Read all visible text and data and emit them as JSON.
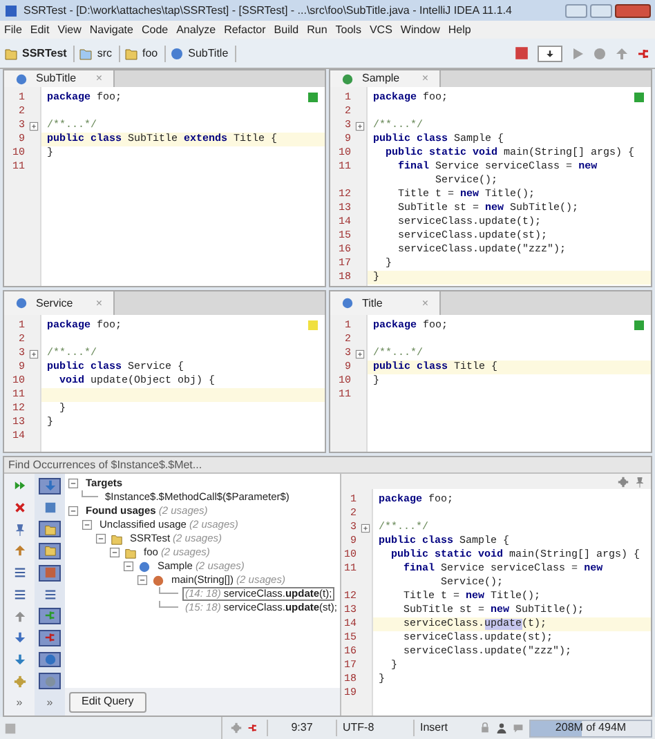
{
  "window": {
    "title": "SSRTest - [D:\\work\\attaches\\tap\\SSRTest] - [SSRTest] - ...\\src\\foo\\SubTitle.java - IntelliJ IDEA 11.1.4"
  },
  "menu": [
    "File",
    "Edit",
    "View",
    "Navigate",
    "Code",
    "Analyze",
    "Refactor",
    "Build",
    "Run",
    "Tools",
    "VCS",
    "Window",
    "Help"
  ],
  "breadcrumbs": [
    {
      "kind": "project",
      "label": "SSRTest"
    },
    {
      "kind": "folder",
      "label": "src"
    },
    {
      "kind": "package",
      "label": "foo"
    },
    {
      "kind": "class",
      "label": "SubTitle"
    }
  ],
  "editors": [
    {
      "tab": {
        "label": "SubTitle",
        "close": "×",
        "kind": "class"
      },
      "color": "#2ea43a",
      "lines": [
        {
          "n": "1",
          "text": "**package** foo;",
          "current": false
        },
        {
          "n": "2",
          "current": false
        },
        {
          "n": "3",
          "text": "/**...*/",
          "kind": "fold",
          "current": false
        },
        {
          "n": "9",
          "text": "**public class** SubTitle **extends** Title {",
          "current": true
        },
        {
          "n": "10",
          "text": "}",
          "current": false
        },
        {
          "n": "11",
          "current": false
        }
      ]
    },
    {
      "tab": {
        "label": "Sample",
        "close": "×",
        "kind": "runnable"
      },
      "color": "#2ea43a",
      "lines": [
        {
          "n": "1",
          "text": "**package** foo;",
          "current": false
        },
        {
          "n": "2",
          "current": false
        },
        {
          "n": "3",
          "text": "/**...*/",
          "kind": "fold",
          "current": false
        },
        {
          "n": "9",
          "text": "**public class** Sample {",
          "current": false
        },
        {
          "n": "10",
          "text": "  **public static void** main(String[] args) {",
          "current": false
        },
        {
          "n": "11",
          "text": "    **final** Service serviceClass = **new**",
          "current": false
        },
        {
          "text": "          Service();",
          "current": false
        },
        {
          "n": "12",
          "text": "    Title t = **new** Title();",
          "current": false
        },
        {
          "n": "13",
          "text": "    SubTitle st = **new** SubTitle();",
          "current": false
        },
        {
          "n": "14",
          "text": "    serviceClass.update(t);",
          "current": false
        },
        {
          "n": "15",
          "text": "    serviceClass.update(st);",
          "current": false
        },
        {
          "n": "16",
          "text": "    serviceClass.update(\"zzz\");",
          "current": false
        },
        {
          "n": "17",
          "text": "  }",
          "current": false
        },
        {
          "n": "18",
          "text": "}",
          "current": true
        }
      ]
    },
    {
      "tab": {
        "label": "Service",
        "close": "×",
        "kind": "class"
      },
      "color": "#f0e040",
      "lines": [
        {
          "n": "1",
          "text": "**package** foo;",
          "current": false
        },
        {
          "n": "2",
          "current": false
        },
        {
          "n": "3",
          "text": "/**...*/",
          "kind": "fold",
          "current": false
        },
        {
          "n": "9",
          "text": "**public class** Service {",
          "current": false
        },
        {
          "n": "10",
          "text": "  **void** update(Object obj) {",
          "current": false
        },
        {
          "n": "11",
          "current": true
        },
        {
          "n": "12",
          "text": "  }",
          "current": false
        },
        {
          "n": "13",
          "text": "}",
          "current": false
        },
        {
          "n": "14",
          "current": false
        }
      ]
    },
    {
      "tab": {
        "label": "Title",
        "close": "×",
        "kind": "class"
      },
      "color": "#2ea43a",
      "lines": [
        {
          "n": "1",
          "text": "**package** foo;",
          "current": false
        },
        {
          "n": "2",
          "current": false
        },
        {
          "n": "3",
          "text": "/**...*/",
          "kind": "fold",
          "current": false
        },
        {
          "n": "9",
          "text": "**public class** Title {",
          "current": true
        },
        {
          "n": "10",
          "text": "}",
          "current": false
        },
        {
          "n": "11",
          "current": false
        }
      ]
    }
  ],
  "find": {
    "title": "Find Occurrences of $Instance$.$Met...",
    "toolbars": [
      {
        "more": "»",
        "buttons": [
          {
            "on": false
          },
          {
            "on": false
          },
          {
            "on": false
          },
          {
            "on": false
          },
          {
            "on": false
          },
          {
            "on": false
          },
          {
            "on": false
          },
          {
            "on": false
          },
          {
            "on": false
          },
          {
            "on": false
          }
        ]
      },
      {
        "more": "»",
        "buttons": [
          {
            "on": true
          },
          {
            "on": false
          },
          {
            "on": true
          },
          {
            "on": true
          },
          {
            "on": true
          },
          {
            "on": false
          },
          {
            "on": true
          },
          {
            "on": true
          },
          {
            "on": true
          },
          {
            "on": true
          }
        ]
      }
    ],
    "tree": [
      {
        "kind": "group",
        "label": "Targets",
        "expanded": true,
        "selected": false,
        "children": [
          {
            "kind": "target",
            "label": "$Instance$.$MethodCall$($Parameter$)",
            "selected": false
          }
        ]
      },
      {
        "kind": "group",
        "label": "Found usages",
        "count": "(2 usages)",
        "expanded": true,
        "selected": false,
        "children": [
          {
            "kind": "plain",
            "label": "Unclassified usage",
            "count": "(2 usages)",
            "expanded": true,
            "selected": false,
            "children": [
              {
                "kind": "project",
                "label": "SSRTest",
                "count": "(2 usages)",
                "expanded": true,
                "selected": false,
                "children": [
                  {
                    "kind": "package",
                    "label": "foo",
                    "count": "(2 usages)",
                    "expanded": true,
                    "selected": false,
                    "children": [
                      {
                        "kind": "class",
                        "label": "Sample",
                        "count": "(2 usages)",
                        "expanded": true,
                        "selected": false,
                        "children": [
                          {
                            "kind": "method",
                            "label": "main(String[])",
                            "count": "(2 usages)",
                            "expanded": true,
                            "selected": false,
                            "children": [
                              {
                                "kind": "usage",
                                "location": "(14: 18)",
                                "label": "serviceClass.**update**(t);",
                                "selected": true
                              },
                              {
                                "kind": "usage",
                                "location": "(15: 18)",
                                "label": "serviceClass.**update**(st);",
                                "selected": false
                              }
                            ]
                          }
                        ]
                      }
                    ]
                  }
                ]
              }
            ]
          }
        ]
      }
    ],
    "edit_button": "Edit Query",
    "preview": {
      "lines": [
        {
          "n": "1",
          "text": "**package** foo;",
          "current": false
        },
        {
          "n": "2",
          "current": false
        },
        {
          "n": "3",
          "text": "/**...*/",
          "kind": "fold",
          "current": false
        },
        {
          "n": "9",
          "text": "**public class** Sample {",
          "current": false
        },
        {
          "n": "10",
          "text": "  **public static void** main(String[] args) {",
          "current": false
        },
        {
          "n": "11",
          "text": "    **final** Service serviceClass = **new**",
          "current": false
        },
        {
          "text": "          Service();",
          "current": false
        },
        {
          "n": "12",
          "text": "    Title t = **new** Title();",
          "current": false
        },
        {
          "n": "13",
          "text": "    SubTitle st = **new** SubTitle();",
          "current": false
        },
        {
          "n": "14",
          "text": "    serviceClass.",
          "match": "update",
          "after": "(t);",
          "current": true
        },
        {
          "n": "15",
          "text": "    serviceClass.update(st);",
          "current": false
        },
        {
          "n": "16",
          "text": "    serviceClass.update(\"zzz\");",
          "current": false
        },
        {
          "n": "17",
          "text": "  }",
          "current": false
        },
        {
          "n": "18",
          "text": "}",
          "current": false
        },
        {
          "n": "19",
          "current": false
        }
      ]
    }
  },
  "status_bar": {
    "position": "9:37",
    "encoding": "UTF-8",
    "mode": "Insert",
    "memory": {
      "text": "208M of 494M",
      "level": 0.42
    }
  }
}
